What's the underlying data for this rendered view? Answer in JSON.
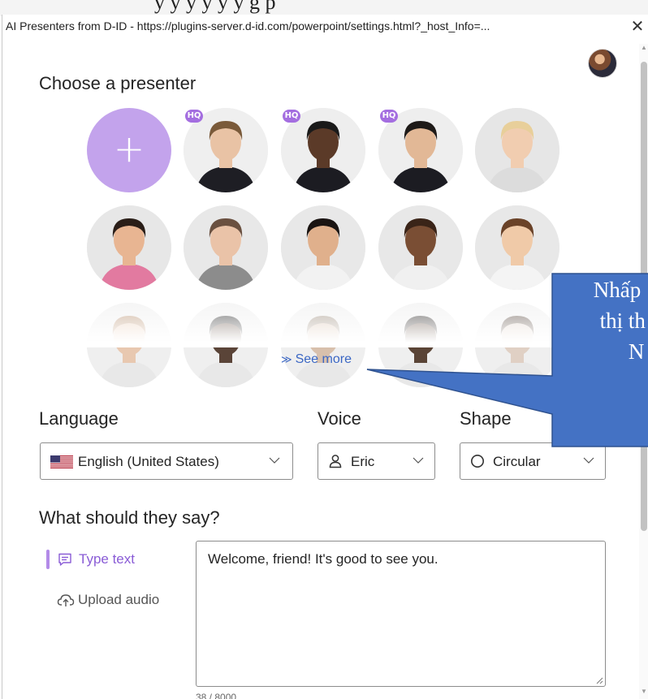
{
  "background": {
    "slide_text": "y  y  y  y  y  y  g  p  "
  },
  "window": {
    "title": "AI Presenters from D-ID - https://plugins-server.d-id.com/powerpoint/settings.html?_host_Info=...",
    "close_glyph": "✕"
  },
  "presenter_section": {
    "title": "Choose a presenter",
    "add_glyph": "+",
    "hq_badge": "HQ",
    "presenters": [
      {
        "hq": true,
        "skin": "#e9c3a5",
        "hair": "#7a5a3a",
        "outfit": "#1e1e24",
        "bg": "#efefef"
      },
      {
        "hq": true,
        "skin": "#5b3a28",
        "hair": "#1a1a1a",
        "outfit": "#1c1c22",
        "bg": "#eeeeee"
      },
      {
        "hq": true,
        "skin": "#e2b896",
        "hair": "#1e1a18",
        "outfit": "#1c1c22",
        "bg": "#eeeeee"
      },
      {
        "hq": false,
        "skin": "#f1cdb0",
        "hair": "#e8cf9a",
        "outfit": "#dcdcdc",
        "bg": "#e6e6e6"
      },
      {
        "hq": false,
        "skin": "#e8b592",
        "hair": "#2a1e18",
        "outfit": "#e27aa0",
        "bg": "#e7e7e7"
      },
      {
        "hq": false,
        "skin": "#eac3a8",
        "hair": "#6a5040",
        "outfit": "#8c8c8c",
        "bg": "#e8e8e8"
      },
      {
        "hq": false,
        "skin": "#e0b08c",
        "hair": "#1a1412",
        "outfit": "#f2f2f2",
        "bg": "#e8e8e8"
      },
      {
        "hq": false,
        "skin": "#7a4e34",
        "hair": "#3a2418",
        "outfit": "#f0f0f0",
        "bg": "#e8e8e8"
      },
      {
        "hq": false,
        "skin": "#f0caa8",
        "hair": "#6a4228",
        "outfit": "#f4f4f4",
        "bg": "#e8e8e8"
      },
      {
        "hq": false,
        "skin": "#e8c8b0",
        "hair": "#b89070",
        "outfit": "#e8e8e8",
        "bg": "#efefef"
      },
      {
        "hq": false,
        "skin": "#5a4438",
        "hair": "#2a2a2a",
        "outfit": "#e8e8e8",
        "bg": "#efefef"
      },
      {
        "hq": false,
        "skin": "#d8c0ac",
        "hair": "#9a8a7a",
        "outfit": "#e8e8e8",
        "bg": "#efefef"
      },
      {
        "hq": false,
        "skin": "#5a4436",
        "hair": "#2a2624",
        "outfit": "#e8e8e8",
        "bg": "#efefef"
      },
      {
        "hq": false,
        "skin": "#e0d0c4",
        "hair": "#5a4a40",
        "outfit": "#e8e8e8",
        "bg": "#efefef"
      }
    ],
    "see_more": "See more",
    "see_more_icon": "chevron-double-down-icon"
  },
  "settings": {
    "language_label": "Language",
    "voice_label": "Voice",
    "shape_label": "Shape",
    "language_value": "English (United States)",
    "voice_value": "Eric",
    "shape_value": "Circular"
  },
  "script_section": {
    "title": "What should they say?",
    "type_text_tab": "Type text",
    "upload_audio_tab": "Upload audio",
    "text_value": "Welcome, friend! It's good to see you.",
    "char_count": "38 / 8000"
  },
  "callout": {
    "text": "Nhấp\n  thị th\n       N",
    "fill": "#4472c4",
    "stroke": "#2f528f"
  },
  "colors": {
    "accent_purple": "#a46ee0",
    "link_blue": "#3a66c4"
  }
}
